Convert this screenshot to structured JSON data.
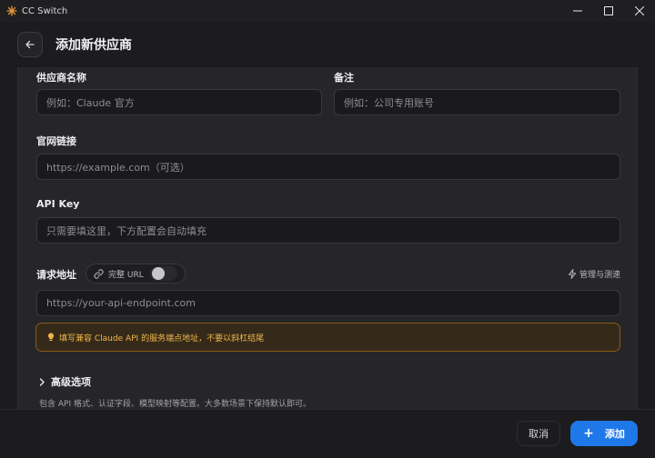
{
  "window": {
    "title": "CC Switch"
  },
  "header": {
    "title": "添加新供应商"
  },
  "form": {
    "provider_name": {
      "label": "供应商名称",
      "placeholder": "例如：Claude 官方"
    },
    "notes": {
      "label": "备注",
      "placeholder": "例如：公司专用账号"
    },
    "website": {
      "label": "官网链接",
      "placeholder": "https://example.com（可选）"
    },
    "api_key": {
      "label": "API Key",
      "placeholder": "只需要填这里，下方配置会自动填充"
    },
    "endpoint": {
      "label": "请求地址",
      "full_url_label": "完整 URL",
      "full_url_enabled": false,
      "manage_label": "管理与测速",
      "placeholder": "https://your-api-endpoint.com"
    },
    "hint": "填写兼容 Claude API 的服务端点地址，不要以斜杠结尾",
    "advanced": {
      "label": "高级选项",
      "description": "包含 API 格式、认证字段、模型映射等配置。大多数场景下保持默认即可。"
    }
  },
  "footer": {
    "cancel_label": "取消",
    "add_label": "添加"
  },
  "colors": {
    "accent": "#1f78e8",
    "warning_text": "#f0b64a",
    "warning_border": "#8a5a1a"
  }
}
